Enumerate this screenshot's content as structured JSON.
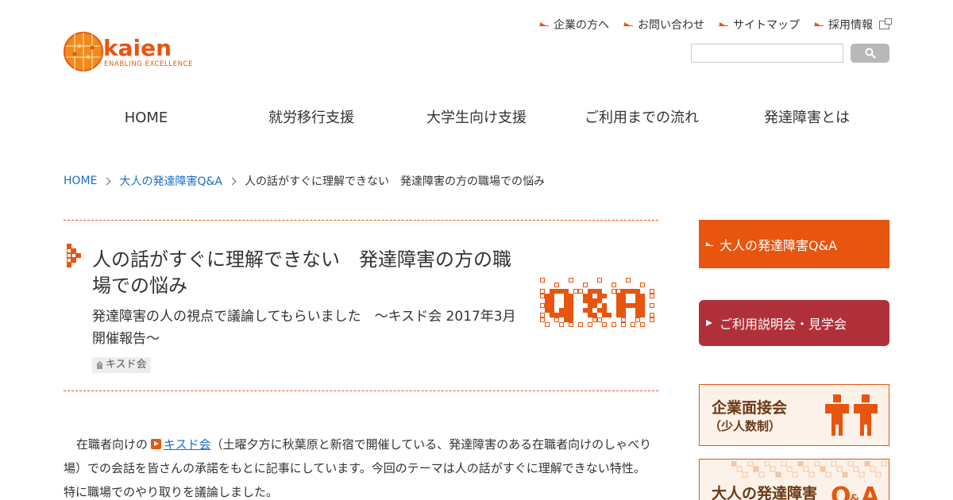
{
  "header": {
    "logo_alt": "kaien ENABLING EXCELLENCE",
    "logo_word": "kaien",
    "logo_tagline": "ENABLING EXCELLENCE",
    "util_nav": [
      {
        "label": "企業の方へ"
      },
      {
        "label": "お問い合わせ"
      },
      {
        "label": "サイトマップ"
      },
      {
        "label": "採用情報"
      }
    ],
    "search": {
      "value": "",
      "placeholder": ""
    }
  },
  "global_nav": [
    {
      "label": "HOME"
    },
    {
      "label": "就労移行支援"
    },
    {
      "label": "大学生向け支援"
    },
    {
      "label": "ご利用までの流れ"
    },
    {
      "label": "発達障害とは"
    }
  ],
  "breadcrumb": {
    "home": "HOME",
    "category": "大人の発達障害Q&A",
    "current": "人の話がすぐに理解できない　発達障害の方の職場での悩み"
  },
  "article": {
    "title": "人の話がすぐに理解できない　発達障害の方の職場での悩み",
    "subtitle": "発達障害の人の視点で議論してもらいました　～キスド会 2017年3月 開催報告～",
    "tag": "キスド会",
    "body_before": "在職者向けの",
    "body_link": "キスド会",
    "body_after": "（土曜夕方に秋葉原と新宿で開催している、発達障害のある在職者向けのしゃべり場）での会話を皆さんの承諾をもとに記事にしています。今回のテーマは人の話がすぐに理解できない特性。特に職場でのやり取りを議論しました。"
  },
  "sidebar": {
    "qa_button": "大人の発達障害Q&A",
    "setsumei_button": "ご利用説明会・見学会",
    "banner_interview_title": "企業面接会",
    "banner_interview_sub": "（少人数制）",
    "banner_qa_title": "大人の発達障害"
  },
  "colors": {
    "accent_orange": "#e8550f",
    "accent_red": "#b0303a",
    "link_blue": "#1a6fc4",
    "banner_brown": "#6a3914"
  }
}
